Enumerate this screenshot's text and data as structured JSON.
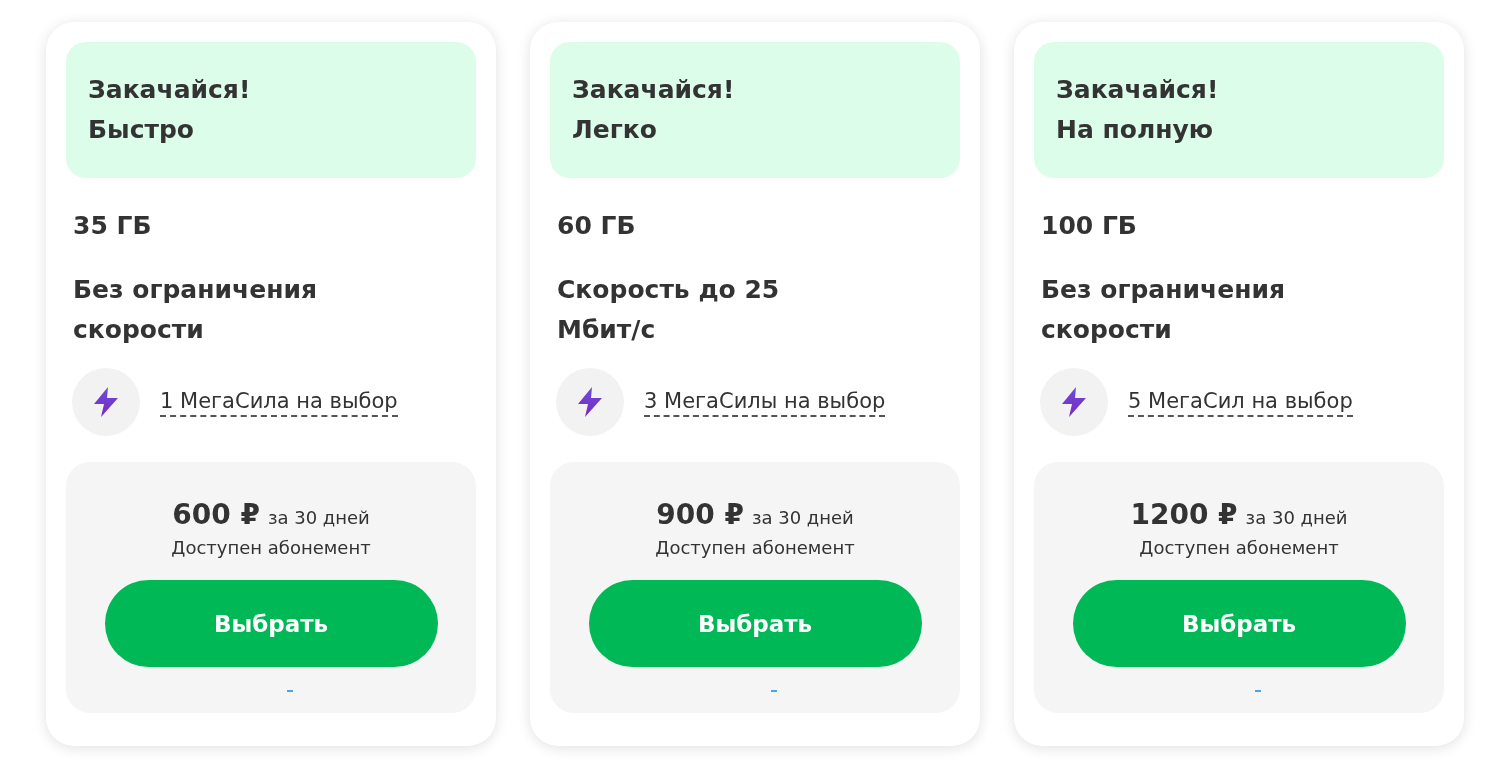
{
  "plans": [
    {
      "title": "Закачайся!",
      "subtitle": "Быстро",
      "volume": "35 ГБ",
      "speed": "Без ограничения скорости",
      "bonus": "1 МегаСила на выбор",
      "price": "600 ₽",
      "period": "за 30 дней",
      "note": "Доступен абонемент",
      "button": "Выбрать"
    },
    {
      "title": "Закачайся!",
      "subtitle": "Легко",
      "volume": "60 ГБ",
      "speed": "Скорость до 25 Мбит/с",
      "bonus": "3 МегаСилы на выбор",
      "price": "900 ₽",
      "period": "за 30 дней",
      "note": "Доступен абонемент",
      "button": "Выбрать"
    },
    {
      "title": "Закачайся!",
      "subtitle": "На полную",
      "volume": "100 ГБ",
      "speed": "Без ограничения скорости",
      "bonus": "5 МегаСил на выбор",
      "price": "1200 ₽",
      "period": "за 30 дней",
      "note": "Доступен абонемент",
      "button": "Выбрать"
    }
  ]
}
